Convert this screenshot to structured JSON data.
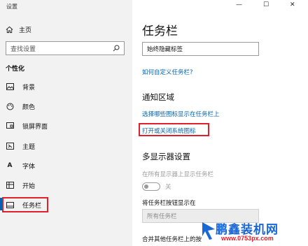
{
  "window": {
    "title": "设置",
    "controls": [
      "—",
      "☐",
      "✕"
    ]
  },
  "sidebar": {
    "home": "主页",
    "search_placeholder": "查找设置",
    "section": "个性化",
    "items": [
      {
        "label": "背景",
        "icon": "picture-icon"
      },
      {
        "label": "颜色",
        "icon": "palette-icon"
      },
      {
        "label": "锁屏界面",
        "icon": "lock-screen-icon"
      },
      {
        "label": "主题",
        "icon": "theme-icon"
      },
      {
        "label": "字体",
        "icon": "font-icon"
      },
      {
        "label": "开始",
        "icon": "start-icon"
      },
      {
        "label": "任务栏",
        "icon": "taskbar-icon",
        "selected": true
      }
    ]
  },
  "main": {
    "title": "任务栏",
    "dropdown_value": "始终隐藏标签",
    "customize_link": "如何自定义任务栏?",
    "notify_heading": "通知区域",
    "notify_link1": "选择哪些图标显示在任务栏上",
    "notify_link2": "打开或关闭系统图标",
    "multi_heading": "多显示器设置",
    "multi_show_label": "在所有显示器上显示任务栏",
    "toggle_label": "关",
    "toggle_on": false,
    "buttons_label": "将任务栏按钮显示在",
    "buttons_value": "所有任务栏",
    "merge_label": "合并其他任务栏上的按"
  },
  "watermark": {
    "line1": "鹏鑫装机网",
    "line2": "www.0753px.com"
  },
  "colors": {
    "accent": "#0063b1",
    "highlight_border": "#e0202a",
    "watermark_blue": "#1a67d6"
  }
}
